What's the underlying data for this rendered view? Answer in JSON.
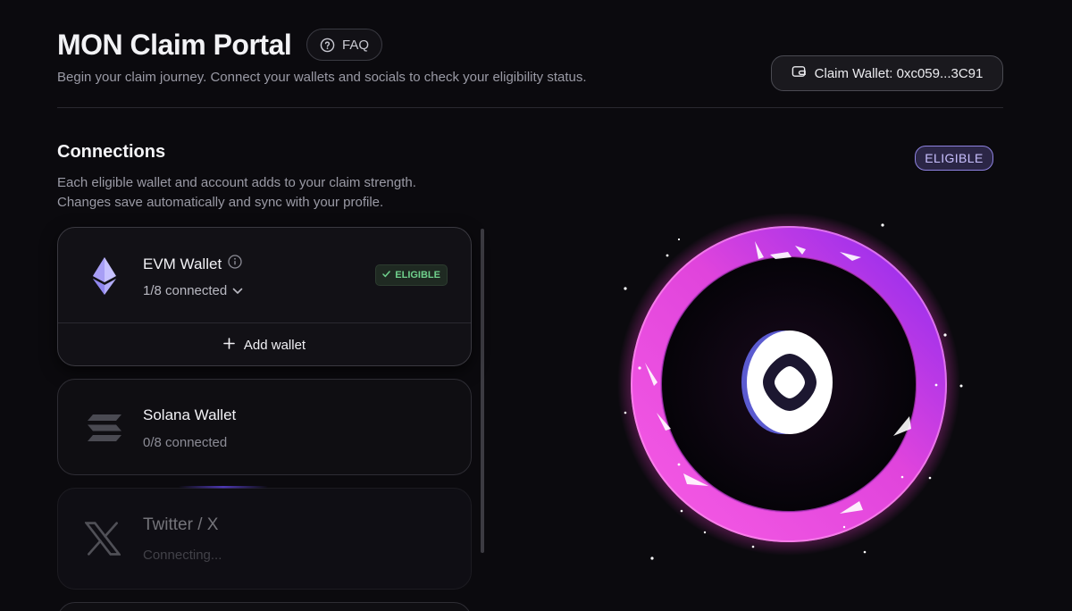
{
  "header": {
    "title": "MON Claim Portal",
    "faq_label": "FAQ",
    "subtitle": "Begin your claim journey. Connect your wallets and socials to check your eligibility status.",
    "claim_wallet_label": "Claim Wallet: 0xc059...3C91"
  },
  "connections": {
    "title": "Connections",
    "description_line1": "Each eligible wallet and account adds to your claim strength.",
    "description_line2": "Changes save automatically and sync with your profile.",
    "cards": [
      {
        "name": "EVM Wallet",
        "status": "1/8 connected",
        "badge": "ELIGIBLE",
        "action": "Add wallet",
        "icon": "ethereum-icon"
      },
      {
        "name": "Solana Wallet",
        "status": "0/8 connected",
        "icon": "solana-icon"
      },
      {
        "name": "Twitter / X",
        "status": "Connecting...",
        "icon": "x-icon"
      }
    ]
  },
  "eligibility": {
    "badge": "ELIGIBLE"
  },
  "colors": {
    "background": "#0b0a0e",
    "accent_purple": "#8e82e0",
    "ring_pink": "#e040d8",
    "ring_purple": "#9a2ff0",
    "eligible_green": "#6fd08c"
  }
}
